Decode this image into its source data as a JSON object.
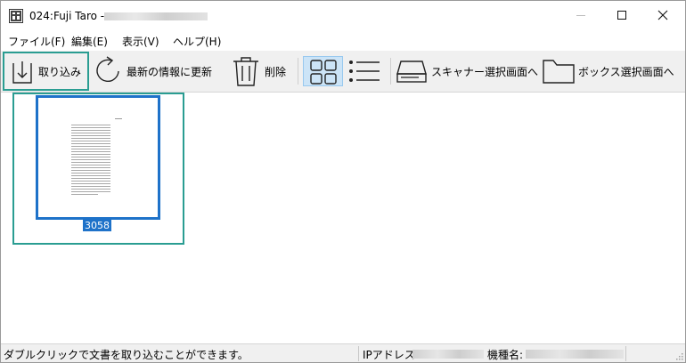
{
  "window": {
    "title": "024:Fuji Taro -"
  },
  "menu": [
    {
      "label": "ファイル(F)"
    },
    {
      "label": "編集(E)"
    },
    {
      "label": "表示(V)"
    },
    {
      "label": "ヘルプ(H)"
    }
  ],
  "toolbar": {
    "import_label": "取り込み",
    "refresh_label": "最新の情報に更新",
    "delete_label": "削除",
    "scanner_label": "スキャナー選択画面へ",
    "box_label": "ボックス選択画面へ"
  },
  "document": {
    "name": "3058"
  },
  "status": {
    "hint": "ダブルクリックで文書を取り込むことができます。",
    "ip_label": "IPアドレス:",
    "model_label": "機種名:"
  },
  "icons": {
    "app": "app-icon",
    "import": "import-arrow-icon",
    "refresh": "refresh-icon",
    "delete": "trash-icon",
    "grid": "thumbnail-view-icon",
    "list": "list-view-icon",
    "scanner": "scanner-icon",
    "folder": "folder-icon"
  },
  "colors": {
    "accent": "#2a9d92",
    "selection": "#1e72c9",
    "toolbar_active": "#cce4f7"
  }
}
